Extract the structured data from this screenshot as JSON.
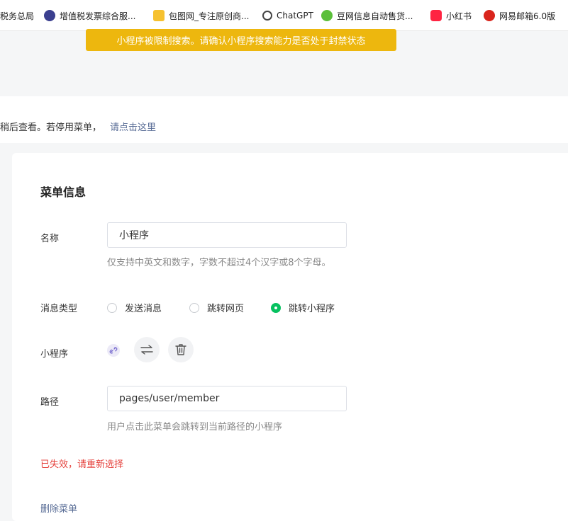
{
  "bookmarks": [
    {
      "label": "税务总局",
      "icon": "tax-icon"
    },
    {
      "label": "增值税发票综合服...",
      "icon": "invoice-icon"
    },
    {
      "label": "包图网_专注原创商...",
      "icon": "baotu-icon"
    },
    {
      "label": "ChatGPT",
      "icon": "chatgpt-icon"
    },
    {
      "label": "豆网信息自动售货...",
      "icon": "douwang-icon"
    },
    {
      "label": "小红书",
      "icon": "xiaohongshu-icon"
    },
    {
      "label": "网易邮箱6.0版",
      "icon": "netease-mail-icon"
    }
  ],
  "notice": "小程序被限制搜索。请确认小程序搜索能力是否处于封禁状态",
  "hint": {
    "text": "稍后查看。若停用菜单，",
    "link": "请点击这里"
  },
  "menu": {
    "section_title": "菜单信息",
    "name_label": "名称",
    "name_value": "小程序",
    "name_help": "仅支持中英文和数字，字数不超过4个汉字或8个字母。",
    "type_label": "消息类型",
    "type_options": [
      "发送消息",
      "跳转网页",
      "跳转小程序"
    ],
    "type_selected": "跳转小程序",
    "miniprogram_label": "小程序",
    "path_label": "路径",
    "path_value": "pages/user/member",
    "path_help": "用户点击此菜单会跳转到当前路径的小程序",
    "error_text": "已失效，请重新选择",
    "delete_link": "删除菜单"
  },
  "colors": {
    "notice_bg": "#edb70e",
    "accent_green": "#07c160",
    "link": "#576b95",
    "error": "#e5413c"
  }
}
